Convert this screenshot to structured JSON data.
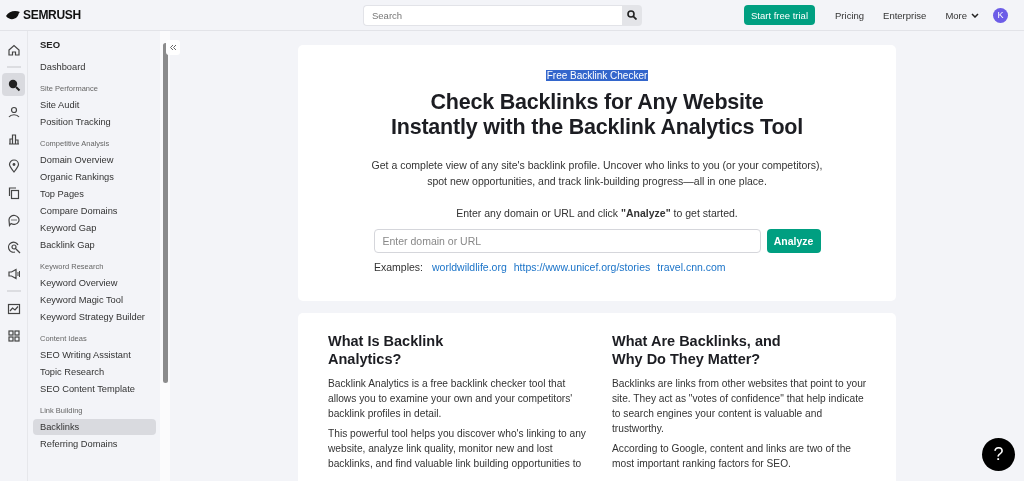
{
  "topbar": {
    "logo": "SEMRUSH",
    "search": {
      "placeholder": "Search"
    },
    "trial_button": "Start free trial",
    "nav": [
      {
        "label": "Pricing",
        "dropdown": false
      },
      {
        "label": "Enterprise",
        "dropdown": false
      },
      {
        "label": "More",
        "dropdown": true
      }
    ],
    "avatar": "K"
  },
  "rail": {
    "groups": [
      [
        {
          "selected": false
        }
      ],
      [
        {
          "selected": true
        },
        {
          "selected": false
        },
        {
          "selected": false
        },
        {
          "selected": false
        },
        {
          "selected": false
        },
        {
          "selected": false
        },
        {
          "selected": false
        },
        {
          "selected": false
        }
      ],
      [
        {
          "selected": false
        },
        {
          "selected": false
        }
      ]
    ]
  },
  "sidebar": {
    "title": "SEO",
    "sections": [
      {
        "items": [
          {
            "label": "Dashboard",
            "selected": false
          }
        ]
      },
      {
        "heading": "Site Performance",
        "items": [
          {
            "label": "Site Audit",
            "selected": false
          },
          {
            "label": "Position Tracking",
            "selected": false
          }
        ]
      },
      {
        "heading": "Competitive Analysis",
        "items": [
          {
            "label": "Domain Overview",
            "selected": false
          },
          {
            "label": "Organic Rankings",
            "selected": false
          },
          {
            "label": "Top Pages",
            "selected": false
          },
          {
            "label": "Compare Domains",
            "selected": false
          },
          {
            "label": "Keyword Gap",
            "selected": false
          },
          {
            "label": "Backlink Gap",
            "selected": false
          }
        ]
      },
      {
        "heading": "Keyword Research",
        "items": [
          {
            "label": "Keyword Overview",
            "selected": false
          },
          {
            "label": "Keyword Magic Tool",
            "selected": false
          },
          {
            "label": "Keyword Strategy Builder",
            "selected": false
          }
        ]
      },
      {
        "heading": "Content Ideas",
        "items": [
          {
            "label": "SEO Writing Assistant",
            "selected": false
          },
          {
            "label": "Topic Research",
            "selected": false
          },
          {
            "label": "SEO Content Template",
            "selected": false
          }
        ]
      },
      {
        "heading": "Link Building",
        "items": [
          {
            "label": "Backlinks",
            "selected": true
          },
          {
            "label": "Referring Domains",
            "selected": false
          }
        ]
      }
    ]
  },
  "hero": {
    "eyebrow": {
      "text": "Free Backlink Checker",
      "selected": true
    },
    "title_lines": [
      "Check Backlinks for Any Website",
      "Instantly with the Backlink Analytics Tool"
    ],
    "description": "Get a complete view of any site's backlink profile. Uncover who links to you (or your competitors), spot new opportunities, and track link-building progress—all in one place.",
    "prompt": "Enter any domain or URL and click **\"Analyze\"** to get started.",
    "input": {
      "placeholder": "Enter domain or URL"
    },
    "button": "Analyze",
    "examples_label": "Examples:",
    "examples": [
      "worldwildlife.org",
      "https://www.unicef.org/stories",
      "travel.cnn.com"
    ]
  },
  "info": {
    "columns": [
      {
        "heading": "What Is Backlink Analytics?",
        "paragraphs": [
          "Backlink Analytics is a free backlink checker tool that allows you to examine your own and your competitors' backlink profiles in detail.",
          "This powerful tool helps you discover who's linking to any website, analyze link quality, monitor new and lost backlinks, and find valuable link building opportunities to"
        ]
      },
      {
        "heading": "What Are Backlinks, and Why Do They Matter?",
        "paragraphs": [
          "Backlinks are links from other websites that point to your site. They act as \"votes of confidence\" that help indicate to search engines your content is valuable and trustworthy.",
          "According to Google, content and links are two of the most important ranking factors for SEO."
        ]
      }
    ]
  },
  "help_button": "?"
}
